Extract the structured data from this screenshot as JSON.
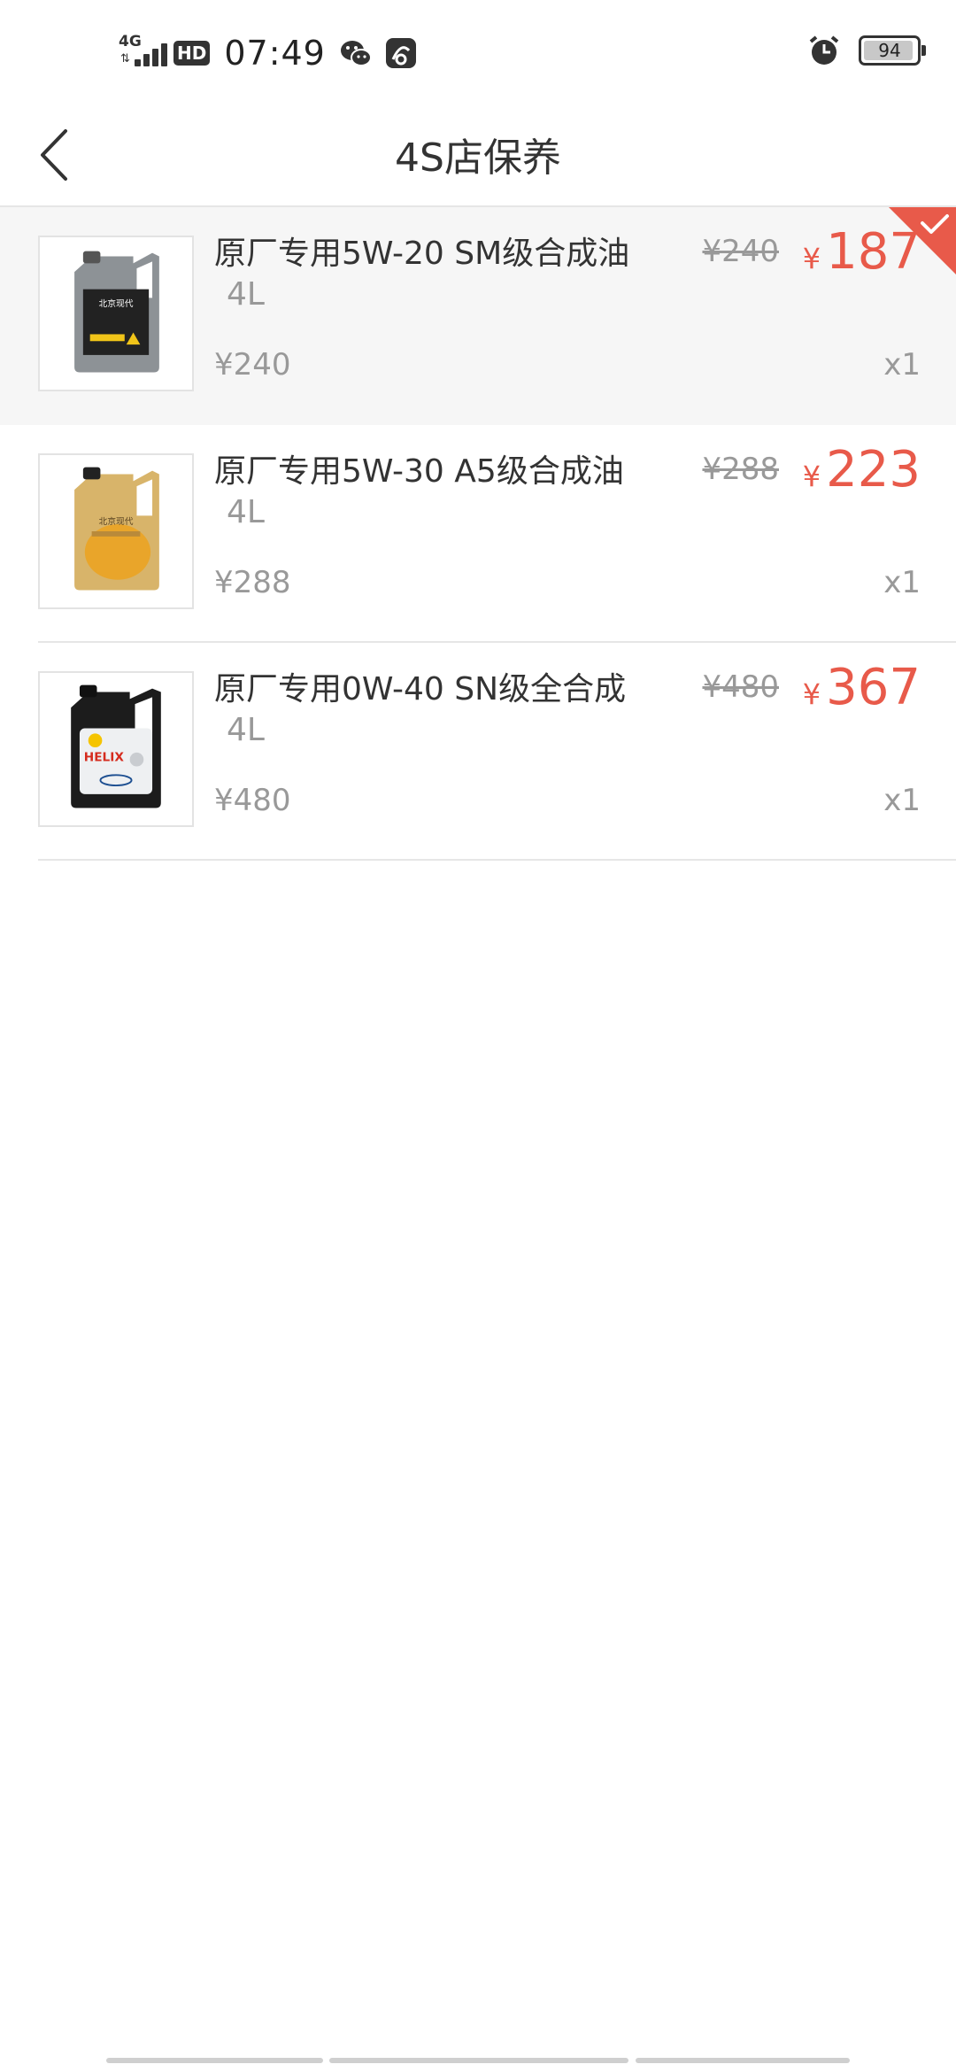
{
  "status_bar": {
    "network": "4G",
    "hd": "HD",
    "time": "07:49",
    "battery": "94"
  },
  "header": {
    "title": "4S店保养"
  },
  "items": [
    {
      "name": "原厂专用5W-20 SM级合成油",
      "size": "4L",
      "original_price": "¥240",
      "currency": "¥",
      "price": "187",
      "base_price": "¥240",
      "quantity": "x1",
      "selected": true
    },
    {
      "name": "原厂专用5W-30 A5级合成油",
      "size": "4L",
      "original_price": "¥288",
      "currency": "¥",
      "price": "223",
      "base_price": "¥288",
      "quantity": "x1",
      "selected": false
    },
    {
      "name": "原厂专用0W-40 SN级全合成",
      "size": "4L",
      "original_price": "¥480",
      "currency": "¥",
      "price": "367",
      "base_price": "¥480",
      "quantity": "x1",
      "selected": false
    }
  ],
  "colors": {
    "accent": "#e85a4a",
    "muted": "#999999",
    "selected_bg": "#f6f6f6"
  }
}
